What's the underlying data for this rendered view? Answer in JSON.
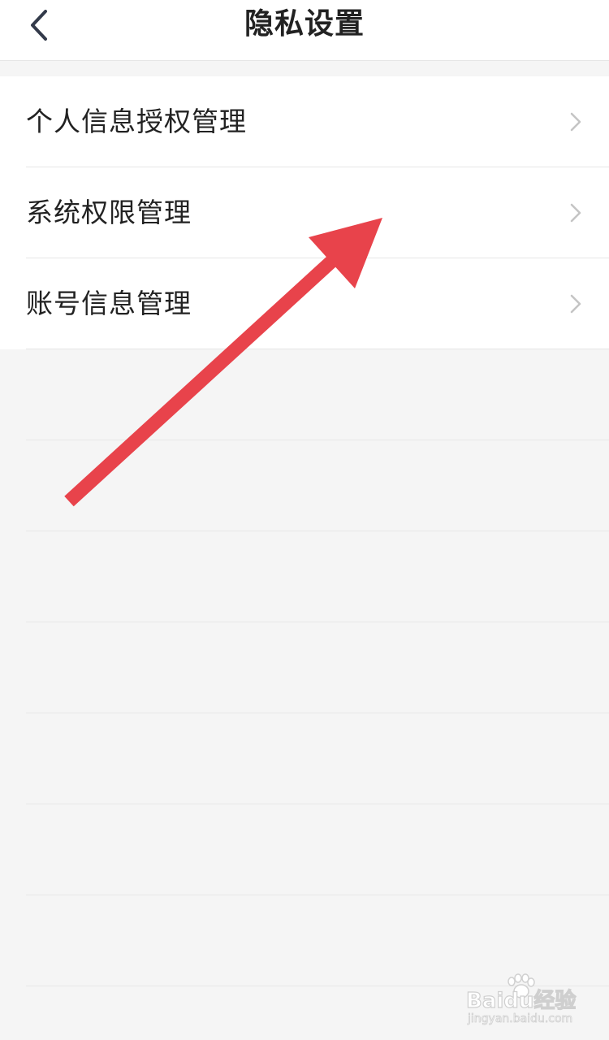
{
  "header": {
    "title": "隐私设置",
    "back_icon": "chevron-left-icon"
  },
  "menu": {
    "items": [
      {
        "label": "个人信息授权管理",
        "icon": "chevron-right-icon"
      },
      {
        "label": "系统权限管理",
        "icon": "chevron-right-icon"
      },
      {
        "label": "账号信息管理",
        "icon": "chevron-right-icon"
      }
    ]
  },
  "annotation": {
    "color": "#e8434b"
  },
  "watermark": {
    "brand": "Baidu经验",
    "url": "jingyan.baidu.com"
  },
  "colors": {
    "background": "#f5f5f5",
    "surface": "#ffffff",
    "text": "#222222",
    "chevron": "#c4c4c4"
  }
}
